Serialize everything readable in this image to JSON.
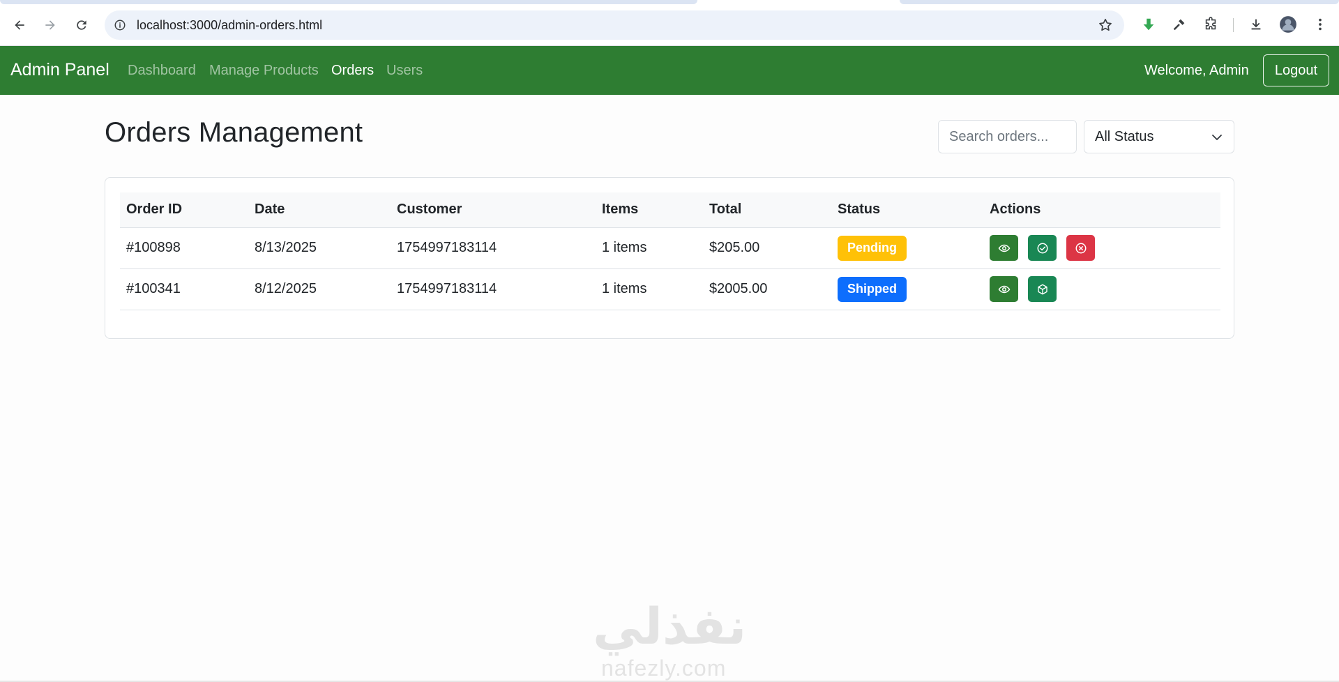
{
  "browser": {
    "url": "localhost:3000/admin-orders.html"
  },
  "navbar": {
    "brand": "Admin Panel",
    "links": [
      {
        "label": "Dashboard",
        "active": false
      },
      {
        "label": "Manage Products",
        "active": false
      },
      {
        "label": "Orders",
        "active": true
      },
      {
        "label": "Users",
        "active": false
      }
    ],
    "welcome": "Welcome, Admin",
    "logout_label": "Logout"
  },
  "page": {
    "title": "Orders Management",
    "search_placeholder": "Search orders...",
    "status_filter": "All Status"
  },
  "table": {
    "headers": [
      "Order ID",
      "Date",
      "Customer",
      "Items",
      "Total",
      "Status",
      "Actions"
    ],
    "rows": [
      {
        "order_id": "#100898",
        "date": "8/13/2025",
        "customer": "1754997183114",
        "items": "1 items",
        "total": "$205.00",
        "status": "Pending",
        "actions": [
          "eye-icon",
          "check-circle-icon",
          "x-circle-icon"
        ]
      },
      {
        "order_id": "#100341",
        "date": "8/12/2025",
        "customer": "1754997183114",
        "items": "1 items",
        "total": "$2005.00",
        "status": "Shipped",
        "actions": [
          "eye-icon",
          "box-icon"
        ]
      }
    ]
  },
  "colors": {
    "navbar": "#2e7d32",
    "pending": "#ffc107",
    "shipped": "#0d6efd",
    "danger": "#dc3545",
    "success": "#198754"
  },
  "watermark": {
    "arabic": "نفذلي",
    "latin": "nafezly.com"
  }
}
